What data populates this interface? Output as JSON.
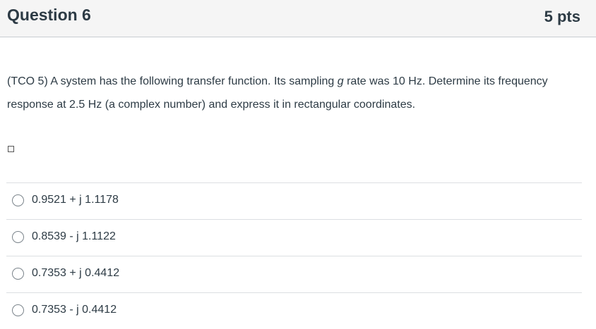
{
  "header": {
    "title": "Question 6",
    "points": "5 pts"
  },
  "question": {
    "text_part1": "(TCO 5) A system has the following transfer function. Its sampling ",
    "italic_word": "g",
    "text_part2": " rate was 10 Hz. Determine its frequency response at 2.5 Hz (a complex number) and express it in rectangular coordinates."
  },
  "answers": [
    {
      "label": "0.9521 + j 1.1178"
    },
    {
      "label": "0.8539 - j 1.1122"
    },
    {
      "label": "0.7353 + j 0.4412"
    },
    {
      "label": "0.7353 - j 0.4412"
    }
  ]
}
